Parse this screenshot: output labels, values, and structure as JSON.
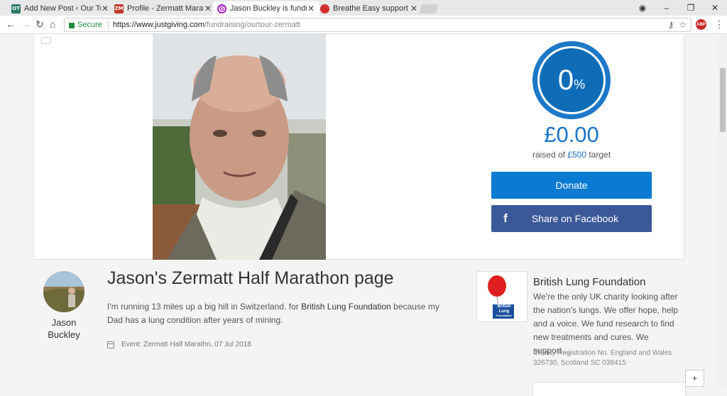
{
  "tabs": [
    {
      "label": "Add New Post ‹ Our Tour",
      "favicon": "OT",
      "color": "#2a7a6a"
    },
    {
      "label": "Profile - Zermatt Marathon",
      "favicon": "ZM",
      "color": "#c0392b"
    },
    {
      "label": "Jason Buckley is fundraising",
      "favicon": "G",
      "color": "#a020c0"
    },
    {
      "label": "Breathe Easy support groups",
      "favicon": "",
      "color": "#d32f2f"
    }
  ],
  "address": {
    "secure_label": "Secure",
    "url_host": "https://www.justgiving.com",
    "url_path": "/fundraising/ourtour-zermatt"
  },
  "hero": {
    "percent": "0",
    "percent_sign": "%",
    "raised": "£0.00",
    "target_prefix": "raised of ",
    "target_amount": "£500",
    "target_suffix": " target",
    "donate_label": "Donate",
    "facebook_icon": "f",
    "facebook_label": "Share on Facebook"
  },
  "fundraiser": {
    "first_name": "Jason",
    "last_name": "Buckley",
    "page_title": "Jason's Zermatt Half Marathon page",
    "story_1": "I'm running 13 miles up a big hill in Switzerland. for ",
    "story_charity": "British Lung Foundation",
    "story_2": " because my Dad has a lung condition after years of mining.",
    "event": "Event: Zermatt Half Marathn, 07 Jul 2018"
  },
  "charity": {
    "name": "British Lung Foundation",
    "description": "We're the only UK charity looking after the nation's lungs. We offer hope, help and a voice. We fund research to find new treatments and cures. We support…",
    "registration": "Charity Registration No. England and Wales 326730, Scotland SC 038415",
    "logo_lines": [
      "British",
      "Lung",
      "Foundation"
    ]
  },
  "colors": {
    "accent": "#0a7ad2",
    "facebook": "#3b5998",
    "ring": "#1e78c8"
  }
}
